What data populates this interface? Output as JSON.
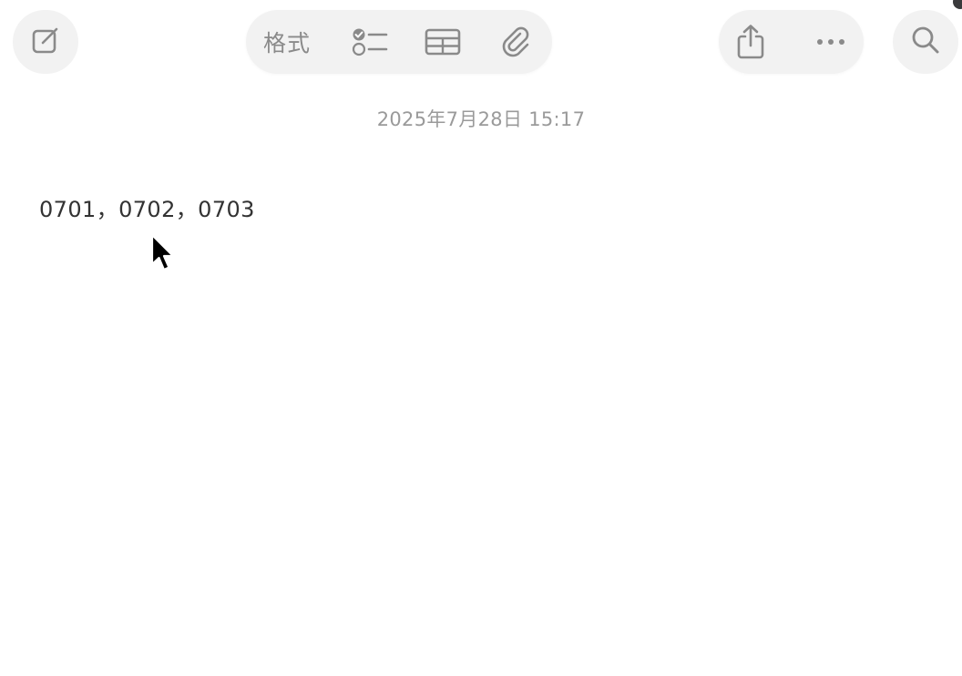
{
  "toolbar": {
    "compose_icon": "compose-icon",
    "format_label": "格式",
    "checklist_icon": "checklist-icon",
    "table_icon": "table-icon",
    "attachment_icon": "paperclip-icon",
    "share_icon": "share-icon",
    "more_icon": "more-icon",
    "search_icon": "search-icon"
  },
  "note": {
    "date": "2025年7月28日 15:17",
    "content": "0701，0702，0703"
  },
  "colors": {
    "toolbar_bg": "#f2f2f2",
    "icon": "#8a8a8a",
    "date_text": "#9a9a9a",
    "body_text": "#333333"
  }
}
